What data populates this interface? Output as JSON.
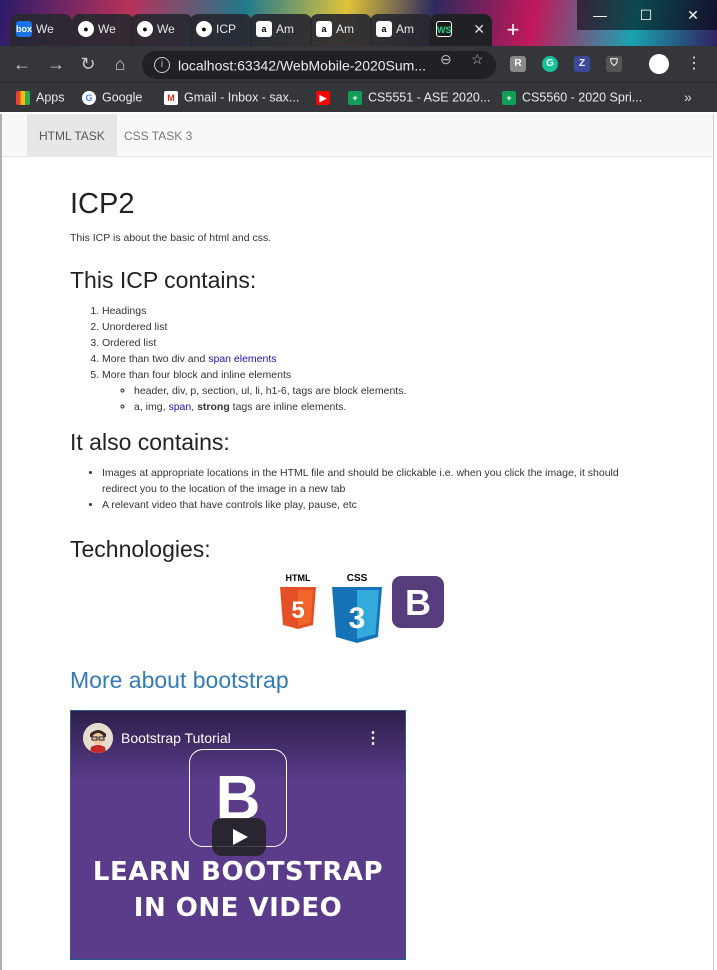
{
  "tabs": [
    {
      "label": "We",
      "favicon": "box-icon"
    },
    {
      "label": "We",
      "favicon": "github-icon"
    },
    {
      "label": "We",
      "favicon": "github-icon"
    },
    {
      "label": "ICP",
      "favicon": "github-icon"
    },
    {
      "label": "Am",
      "favicon": "amazon-icon"
    },
    {
      "label": "Am",
      "favicon": "amazon-icon"
    },
    {
      "label": "Am",
      "favicon": "amazon-icon"
    },
    {
      "label": "",
      "favicon": "webstorm-icon",
      "active": true
    }
  ],
  "tab_close": "✕",
  "new_tab": "+",
  "window": {
    "minimize": "—",
    "maximize": "☐",
    "close": "✕"
  },
  "toolbar": {
    "back": "←",
    "forward": "→",
    "reload": "↻",
    "home": "⌂",
    "url": "localhost:63342/WebMobile-2020Sum...",
    "info": "i"
  },
  "bookmarks": [
    {
      "label": "Apps",
      "icon": "apps-grid-icon"
    },
    {
      "label": "Google",
      "icon": "google-icon"
    },
    {
      "label": "Gmail - Inbox - sax...",
      "icon": "gmail-icon"
    },
    {
      "label": "",
      "icon": "youtube-icon"
    },
    {
      "label": "CS5551 - ASE 2020...",
      "icon": "green-doc-icon"
    },
    {
      "label": "CS5560 - 2020 Spri...",
      "icon": "green-doc-icon"
    }
  ],
  "bookmarks_more": "»",
  "nav": {
    "tabs": [
      "HTML TASK",
      "CSS TASK 3"
    ]
  },
  "content": {
    "title": "ICP2",
    "intro": "This ICP is about the basic of html and css.",
    "contains_heading": "This ICP contains:",
    "ol": [
      "Headings",
      "Unordered list",
      "Ordered list",
      "More than two div and ",
      "More than four block and inline elements"
    ],
    "ol_span": "span elements",
    "nested_1": "header, div, p, section, ul, li, h1-6, tags are block elements.",
    "nested_2_prefix": "a, img, ",
    "nested_2_span": "span",
    "nested_2_mid": ", ",
    "nested_2_strong": "strong",
    "nested_2_suffix": " tags are inline elements.",
    "also_heading": "It also contains:",
    "ul": [
      "Images at appropriate locations in the HTML file and should be clickable i.e. when you click the image, it should redirect you to the location of the image in a new tab",
      "A relevant video that have controls like play, pause, etc"
    ],
    "tech_heading": "Technologies:",
    "logos": {
      "html": "HTML",
      "html_num": "5",
      "css": "CSS",
      "css_num": "3",
      "bootstrap": "B"
    },
    "more_heading": "More about bootstrap",
    "video": {
      "title": "Bootstrap Tutorial",
      "line1": "LEARN BOOTSTRAP",
      "line2": "IN ONE VIDEO",
      "logo": "B",
      "menu": "⋮"
    }
  }
}
